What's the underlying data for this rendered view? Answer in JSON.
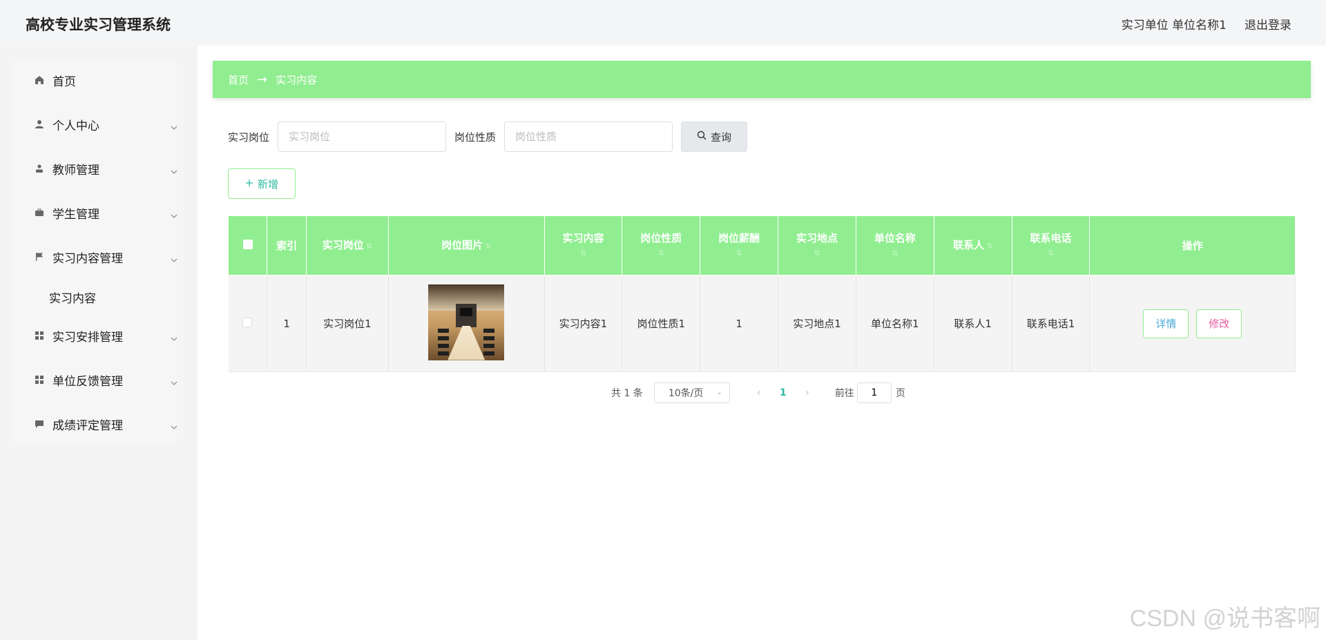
{
  "app": {
    "title": "高校专业实习管理系统"
  },
  "header": {
    "user_info": "实习单位 单位名称1",
    "logout": "退出登录"
  },
  "sidebar": {
    "items": [
      {
        "label": "首页",
        "icon": "home-icon"
      },
      {
        "label": "个人中心",
        "icon": "user-icon"
      },
      {
        "label": "教师管理",
        "icon": "teacher-icon"
      },
      {
        "label": "学生管理",
        "icon": "briefcase-icon"
      },
      {
        "label": "实习内容管理",
        "icon": "flag-icon"
      },
      {
        "label": "实习安排管理",
        "icon": "grid-icon"
      },
      {
        "label": "单位反馈管理",
        "icon": "grid-icon"
      },
      {
        "label": "成绩评定管理",
        "icon": "chat-icon"
      }
    ],
    "submenu": {
      "label": "实习内容"
    }
  },
  "breadcrumb": {
    "home": "首页",
    "arrow": "→",
    "current": "实习内容"
  },
  "search": {
    "position_label": "实习岗位",
    "position_placeholder": "实习岗位",
    "nature_label": "岗位性质",
    "nature_placeholder": "岗位性质",
    "query_button": "查询"
  },
  "actions": {
    "add_button": "新增"
  },
  "table": {
    "headers": {
      "index": "索引",
      "position": "实习岗位",
      "image": "岗位图片",
      "content": "实习内容",
      "nature": "岗位性质",
      "salary": "岗位薪酬",
      "location": "实习地点",
      "company": "单位名称",
      "contact": "联系人",
      "phone": "联系电话",
      "ops": "操作"
    },
    "rows": [
      {
        "index": "1",
        "position": "实习岗位1",
        "content": "实习内容1",
        "nature": "岗位性质1",
        "salary": "1",
        "location": "实习地点1",
        "company": "单位名称1",
        "contact": "联系人1",
        "phone": "联系电话1",
        "detail_button": "详情",
        "edit_button": "修改"
      }
    ]
  },
  "pagination": {
    "total": "共 1 条",
    "page_size": "10条/页",
    "current_page": "1",
    "goto_label": "前往",
    "goto_value": "1",
    "page_suffix": "页"
  },
  "watermark": "CSDN @说书客啊",
  "colors": {
    "accent": "#90ee90",
    "link": "#2fb99f",
    "detail": "#49a8d8",
    "edit": "#e85a9e"
  }
}
